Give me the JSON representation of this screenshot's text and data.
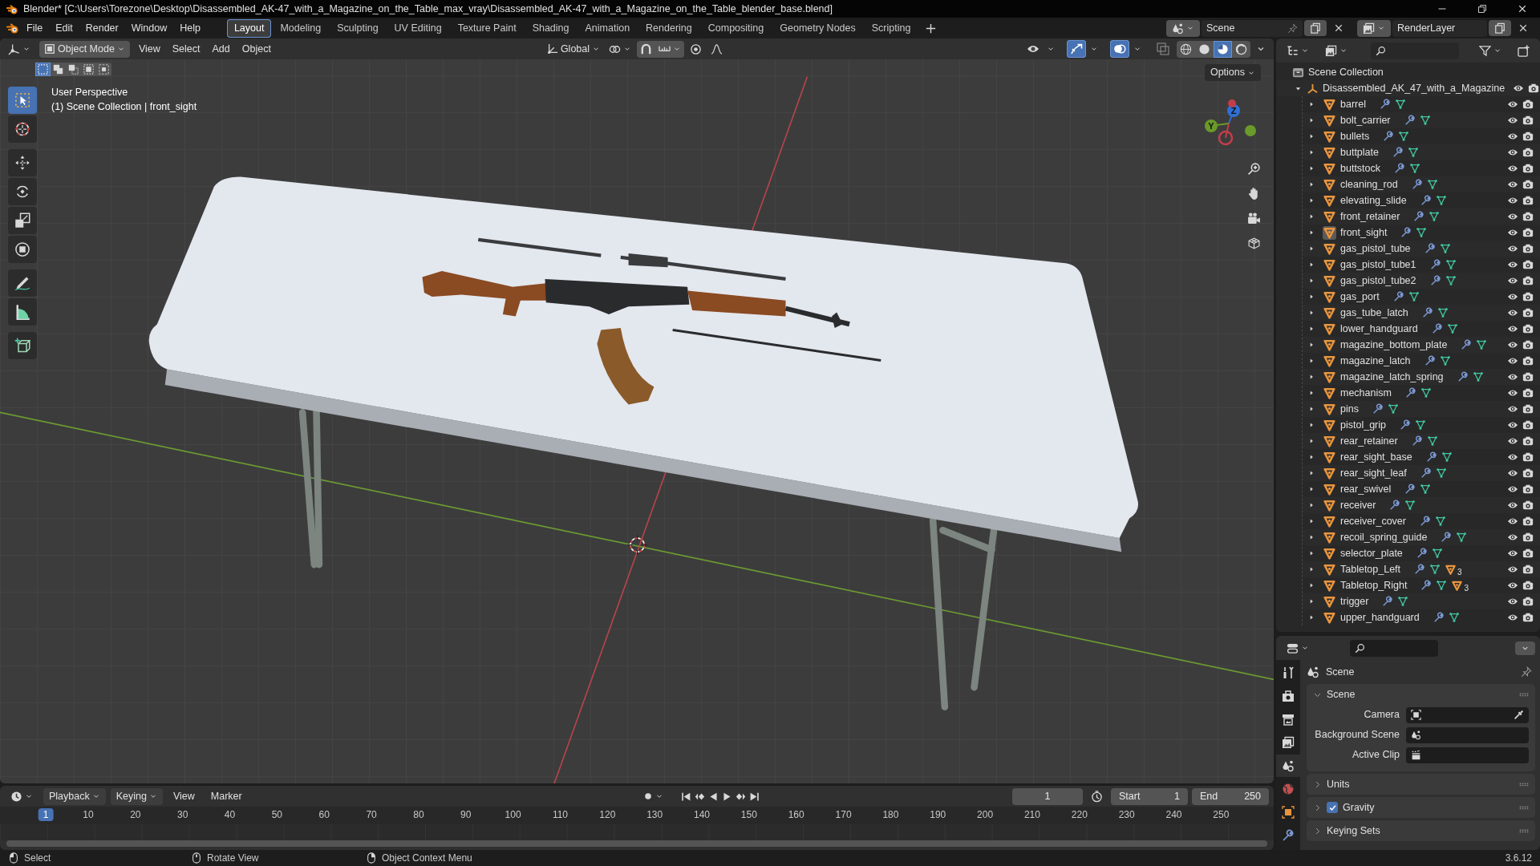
{
  "window": {
    "title": "Blender* [C:\\Users\\Torezone\\Desktop\\Disassembled_AK-47_with_a_Magazine_on_the_Table_max_vray\\Disassembled_AK-47_with_a_Magazine_on_the_Table_blender_base.blend]"
  },
  "menu": [
    "File",
    "Edit",
    "Render",
    "Window",
    "Help"
  ],
  "workspaces": [
    {
      "label": "Layout",
      "selected": true
    },
    {
      "label": "Modeling",
      "selected": false
    },
    {
      "label": "Sculpting",
      "selected": false
    },
    {
      "label": "UV Editing",
      "selected": false
    },
    {
      "label": "Texture Paint",
      "selected": false
    },
    {
      "label": "Shading",
      "selected": false
    },
    {
      "label": "Animation",
      "selected": false
    },
    {
      "label": "Rendering",
      "selected": false
    },
    {
      "label": "Compositing",
      "selected": false
    },
    {
      "label": "Geometry Nodes",
      "selected": false
    },
    {
      "label": "Scripting",
      "selected": false
    }
  ],
  "scene": "Scene",
  "view_layer": "RenderLayer",
  "viewport": {
    "mode": "Object Mode",
    "menus": [
      "View",
      "Select",
      "Add",
      "Object"
    ],
    "orientation": "Global",
    "options": "Options",
    "select_modes": [
      {
        "kind": "new",
        "selected": true
      },
      {
        "kind": "extend",
        "selected": false
      },
      {
        "kind": "subtract",
        "selected": false
      },
      {
        "kind": "invert",
        "selected": false
      },
      {
        "kind": "intersect",
        "selected": false
      }
    ],
    "toggles": [
      {
        "kind": "visibility",
        "on": false
      },
      {
        "kind": "gizmos",
        "on": true
      },
      {
        "kind": "overlays",
        "on": true
      },
      {
        "kind": "xray",
        "on": false
      }
    ],
    "shading": [
      {
        "kind": "wireframe",
        "selected": false
      },
      {
        "kind": "solid",
        "selected": false
      },
      {
        "kind": "material",
        "selected": true
      },
      {
        "kind": "rendered",
        "selected": false
      }
    ],
    "info": [
      "User Perspective",
      "(1) Scene Collection | front_sight"
    ],
    "tools": [
      {
        "kind": "select",
        "selected": true
      },
      {
        "kind": "cursor",
        "selected": false
      },
      {
        "kind": "move",
        "selected": false
      },
      {
        "kind": "rotate",
        "selected": false
      },
      {
        "kind": "scale",
        "selected": false
      },
      {
        "kind": "transform",
        "selected": false
      },
      {
        "kind": "annotate",
        "selected": false
      },
      {
        "kind": "measure",
        "selected": false
      },
      {
        "kind": "add_cube",
        "selected": false
      }
    ],
    "gizmo_axes": [
      "Z",
      "Y"
    ]
  },
  "outliner": {
    "root": "Scene Collection",
    "collections": [
      {
        "name": "Disassembled_AK_47_with_a_Magazine",
        "expanded": true,
        "children": [
          {
            "name": "barrel",
            "active": false,
            "expanded": false
          },
          {
            "name": "bolt_carrier",
            "active": false,
            "expanded": false
          },
          {
            "name": "bullets",
            "active": false,
            "expanded": false
          },
          {
            "name": "buttplate",
            "active": false,
            "expanded": false
          },
          {
            "name": "buttstock",
            "active": false,
            "expanded": false
          },
          {
            "name": "cleaning_rod",
            "active": false,
            "expanded": false
          },
          {
            "name": "elevating_slide",
            "active": false,
            "expanded": false
          },
          {
            "name": "front_retainer",
            "active": false,
            "expanded": false
          },
          {
            "name": "front_sight",
            "active": true,
            "expanded": false
          },
          {
            "name": "gas_pistol_tube",
            "active": false,
            "expanded": false
          },
          {
            "name": "gas_pistol_tube1",
            "active": false,
            "expanded": false
          },
          {
            "name": "gas_pistol_tube2",
            "active": false,
            "expanded": false
          },
          {
            "name": "gas_port",
            "active": false,
            "expanded": false
          },
          {
            "name": "gas_tube_latch",
            "active": false,
            "expanded": false
          },
          {
            "name": "lower_handguard",
            "active": false,
            "expanded": false
          },
          {
            "name": "magazine_bottom_plate",
            "active": false,
            "expanded": false
          },
          {
            "name": "magazine_latch",
            "active": false,
            "expanded": false
          },
          {
            "name": "magazine_latch_spring",
            "active": false,
            "expanded": false
          },
          {
            "name": "mechanism",
            "active": false,
            "expanded": false
          },
          {
            "name": "pins",
            "active": false,
            "expanded": false
          },
          {
            "name": "pistol_grip",
            "active": false,
            "expanded": false
          },
          {
            "name": "rear_retainer",
            "active": false,
            "expanded": false
          },
          {
            "name": "rear_sight_base",
            "active": false,
            "expanded": false
          },
          {
            "name": "rear_sight_leaf",
            "active": false,
            "expanded": false
          },
          {
            "name": "rear_swivel",
            "active": false,
            "expanded": false
          },
          {
            "name": "receiver",
            "active": false,
            "expanded": false
          },
          {
            "name": "receiver_cover",
            "active": false,
            "expanded": false
          },
          {
            "name": "recoil_spring_guide",
            "active": false,
            "expanded": false
          },
          {
            "name": "selector_plate",
            "active": false,
            "expanded": false
          },
          {
            "name": "Tabletop_Left",
            "active": false,
            "expanded": false,
            "child_count": "3"
          },
          {
            "name": "Tabletop_Right",
            "active": false,
            "expanded": false,
            "child_count": "3"
          },
          {
            "name": "trigger",
            "active": false,
            "expanded": false
          },
          {
            "name": "upper_handguard",
            "active": false,
            "expanded": false
          }
        ]
      }
    ]
  },
  "properties": {
    "tabs": [
      {
        "kind": "tool",
        "selected": false
      },
      {
        "kind": "render",
        "selected": false
      },
      {
        "kind": "output",
        "selected": false
      },
      {
        "kind": "view_layer",
        "selected": false
      },
      {
        "kind": "scene",
        "selected": true
      },
      {
        "kind": "world",
        "selected": false
      },
      {
        "kind": "object",
        "selected": false
      },
      {
        "kind": "modifiers",
        "selected": false
      }
    ],
    "context": "Scene",
    "panels": [
      {
        "title": "Scene",
        "kind": "plain",
        "expanded": true,
        "fields": [
          {
            "label": "Camera",
            "kind": "camera"
          },
          {
            "label": "Background Scene",
            "kind": "scene"
          },
          {
            "label": "Active Clip",
            "kind": "clip"
          }
        ]
      },
      {
        "title": "Units",
        "kind": "plain",
        "expanded": false
      },
      {
        "title": "Gravity",
        "kind": "checkbox",
        "checked": true,
        "expanded": false
      },
      {
        "title": "Keying Sets",
        "kind": "plain",
        "expanded": false
      }
    ]
  },
  "timeline": {
    "menus": [
      {
        "label": "Playback",
        "dropdown": true
      },
      {
        "label": "Keying",
        "dropdown": true
      },
      {
        "label": "View",
        "dropdown": false
      },
      {
        "label": "Marker",
        "dropdown": false
      }
    ],
    "current_frame": "1",
    "start_label": "Start",
    "start": "1",
    "end_label": "End",
    "end": "250",
    "playhead": "1",
    "ruler": [
      "10",
      "20",
      "30",
      "40",
      "50",
      "60",
      "70",
      "80",
      "90",
      "100",
      "110",
      "120",
      "130",
      "140",
      "150",
      "160",
      "170",
      "180",
      "190",
      "200",
      "210",
      "220",
      "230",
      "240",
      "250"
    ]
  },
  "status_bar": {
    "hints": [
      {
        "kind": "lmb",
        "label": "Select"
      },
      {
        "kind": "mmb",
        "label": "Rotate View"
      },
      {
        "kind": "rmb",
        "label": "Object Context Menu"
      }
    ],
    "version": "3.6.12"
  }
}
